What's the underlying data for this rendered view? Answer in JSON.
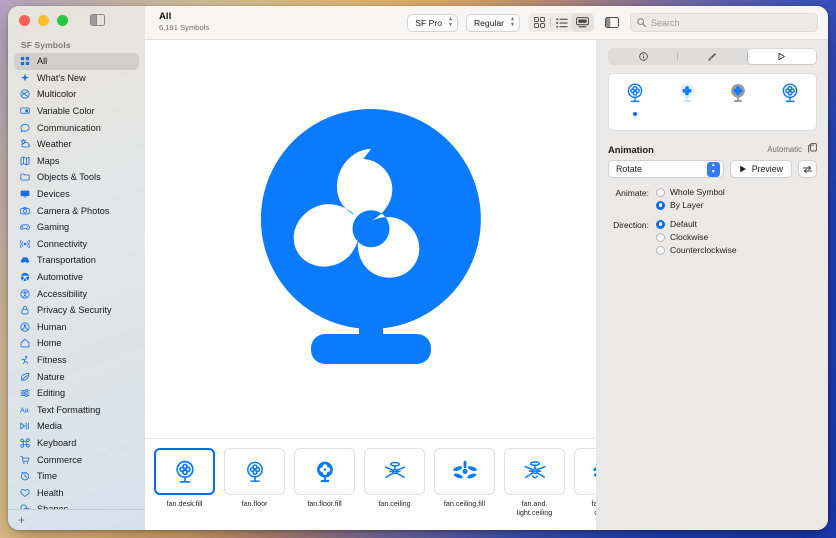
{
  "app": {
    "name": "SF Symbols"
  },
  "sidebar": {
    "header": "SF Symbols",
    "add_label": "+",
    "items": [
      {
        "label": "All",
        "icon": "grid-icon",
        "selected": true
      },
      {
        "label": "What's New",
        "icon": "sparkle-icon",
        "selected": false
      },
      {
        "label": "Multicolor",
        "icon": "multicolor-icon",
        "selected": false
      },
      {
        "label": "Variable Color",
        "icon": "variable-color-icon",
        "selected": false
      },
      {
        "label": "Communication",
        "icon": "bubble-icon",
        "selected": false
      },
      {
        "label": "Weather",
        "icon": "cloud-sun-icon",
        "selected": false
      },
      {
        "label": "Maps",
        "icon": "map-icon",
        "selected": false
      },
      {
        "label": "Objects & Tools",
        "icon": "folder-icon",
        "selected": false
      },
      {
        "label": "Devices",
        "icon": "display-icon",
        "selected": false
      },
      {
        "label": "Camera & Photos",
        "icon": "camera-icon",
        "selected": false
      },
      {
        "label": "Gaming",
        "icon": "gamecontroller-icon",
        "selected": false
      },
      {
        "label": "Connectivity",
        "icon": "antenna-icon",
        "selected": false
      },
      {
        "label": "Transportation",
        "icon": "car-icon",
        "selected": false
      },
      {
        "label": "Automotive",
        "icon": "steeringwheel-icon",
        "selected": false
      },
      {
        "label": "Accessibility",
        "icon": "accessibility-icon",
        "selected": false
      },
      {
        "label": "Privacy & Security",
        "icon": "lock-icon",
        "selected": false
      },
      {
        "label": "Human",
        "icon": "person-icon",
        "selected": false
      },
      {
        "label": "Home",
        "icon": "house-icon",
        "selected": false
      },
      {
        "label": "Fitness",
        "icon": "figure-run-icon",
        "selected": false
      },
      {
        "label": "Nature",
        "icon": "leaf-icon",
        "selected": false
      },
      {
        "label": "Editing",
        "icon": "sliders-icon",
        "selected": false
      },
      {
        "label": "Text Formatting",
        "icon": "textformat-icon",
        "selected": false
      },
      {
        "label": "Media",
        "icon": "playpause-icon",
        "selected": false
      },
      {
        "label": "Keyboard",
        "icon": "command-icon",
        "selected": false
      },
      {
        "label": "Commerce",
        "icon": "cart-icon",
        "selected": false
      },
      {
        "label": "Time",
        "icon": "timer-icon",
        "selected": false
      },
      {
        "label": "Health",
        "icon": "heart-icon",
        "selected": false
      },
      {
        "label": "Shapes",
        "icon": "shapes-icon",
        "selected": false
      }
    ]
  },
  "toolbar": {
    "title": "All",
    "subtitle": "6,191 Symbols",
    "font_popup": "SF Pro",
    "weight_popup": "Regular",
    "view_grid": "grid-view-icon",
    "view_list": "list-view-icon",
    "view_gallery": "gallery-view-icon",
    "active_view": "gallery-view-icon",
    "inspector_toggle": "inspector-toggle-icon",
    "search_placeholder": "Search",
    "search_value": ""
  },
  "canvas": {
    "symbol_name": "fan.desk.fill",
    "symbol_color": "#0a7bff"
  },
  "grid": {
    "items": [
      {
        "name": "fan.desk.fill",
        "selected": true
      },
      {
        "name": "fan.floor",
        "selected": false
      },
      {
        "name": "fan.floor.fill",
        "selected": false
      },
      {
        "name": "fan.ceiling",
        "selected": false
      },
      {
        "name": "fan.ceiling.fill",
        "selected": false
      },
      {
        "name": "fan.and.\nlight.ceiling",
        "selected": false
      },
      {
        "name": "fan.and.\nceiling",
        "selected": false
      }
    ]
  },
  "inspector": {
    "tabs": [
      {
        "name": "info-tab",
        "icon": "info-circle-icon",
        "active": false
      },
      {
        "name": "layers-tab",
        "icon": "paintbrush-icon",
        "active": false
      },
      {
        "name": "animation-tab",
        "icon": "play-triangle-icon",
        "active": true
      }
    ],
    "render_modes": [
      {
        "name": "monochrome",
        "selected": true
      },
      {
        "name": "hierarchical",
        "selected": false
      },
      {
        "name": "palette",
        "selected": false
      },
      {
        "name": "multicolor",
        "selected": false
      }
    ],
    "animation": {
      "section_title": "Animation",
      "automatic_label": "Automatic",
      "copy_icon": "copy-icon",
      "selected_animation": "Rotate",
      "preview_label": "Preview",
      "play_icon": "play-icon",
      "loop_icon": "loop-icon",
      "animate_label": "Animate:",
      "animate_options": [
        {
          "label": "Whole Symbol",
          "selected": false
        },
        {
          "label": "By Layer",
          "selected": true
        }
      ],
      "direction_label": "Direction:",
      "direction_options": [
        {
          "label": "Default",
          "selected": true
        },
        {
          "label": "Clockwise",
          "selected": false
        },
        {
          "label": "Counterclockwise",
          "selected": false
        }
      ]
    }
  },
  "accent_color": "#0a6cf1"
}
